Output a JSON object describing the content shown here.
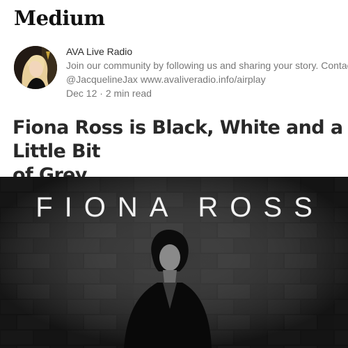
{
  "site": {
    "brand": "Medium"
  },
  "author": {
    "name": "AVA Live Radio",
    "bio_line1": "Join our community by following us and sharing your story. Contact",
    "bio_line2": "@JacquelineJax www.avaliveradio.info/airplay",
    "avatar_icon": "avatar-photo"
  },
  "post": {
    "date": "Dec 12",
    "separator": "·",
    "read_time": "2 min read",
    "title": "Fiona Ross is Black, White and a Little Bit\nof Grey"
  },
  "hero": {
    "overlay_text": "FIONA ROSS",
    "background_color": "#1a1a1a"
  }
}
